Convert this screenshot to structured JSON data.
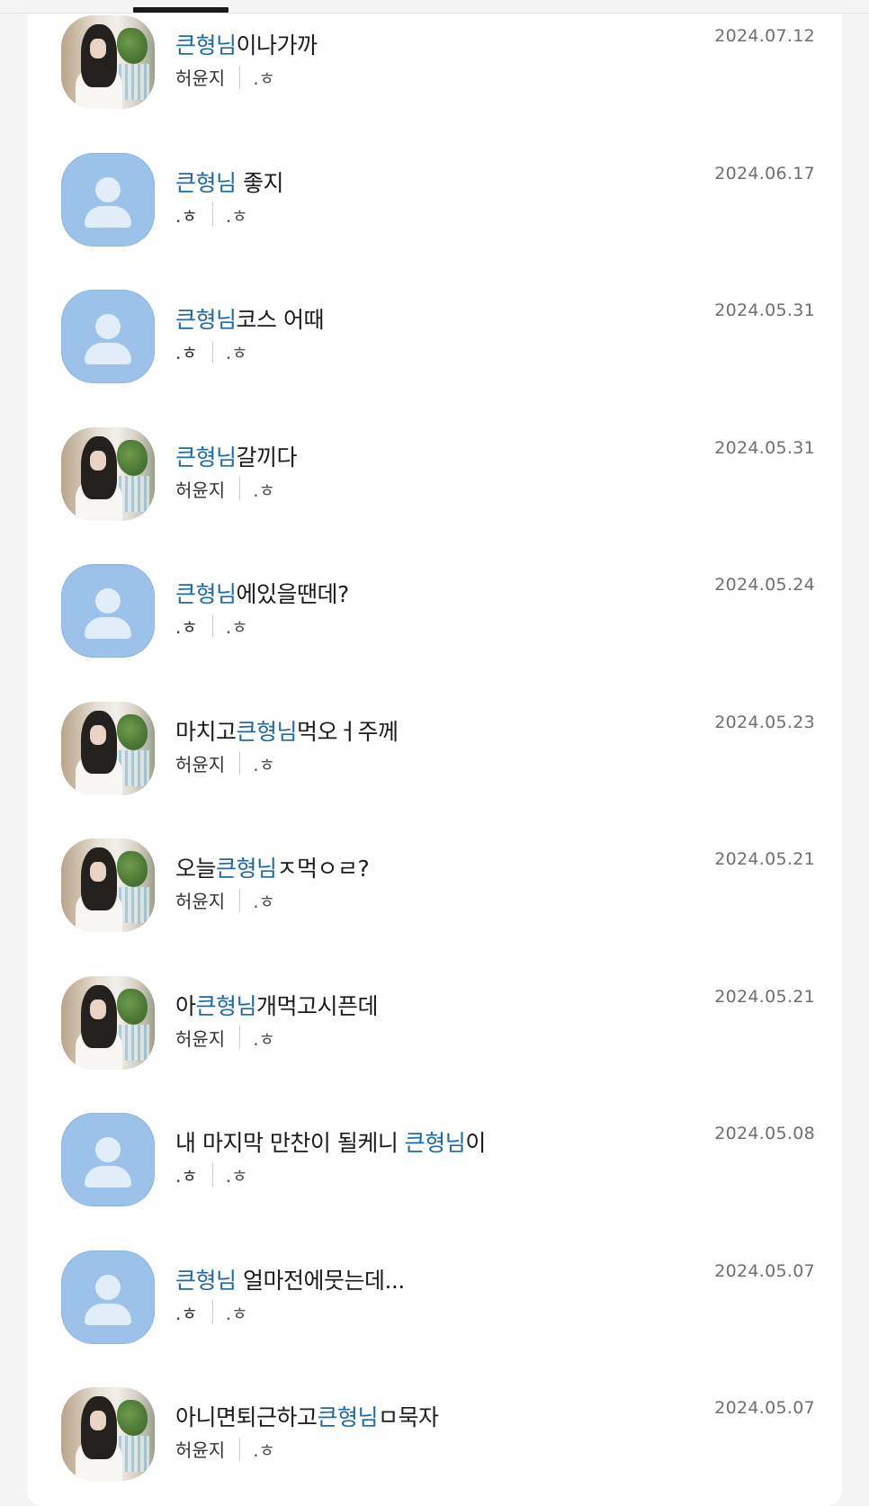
{
  "items": [
    {
      "avatar": "photo-avatar",
      "pre": "",
      "hl": "큰형님",
      "post": "이나가까",
      "author": "허윤지",
      "tag": ".ㅎ",
      "date": "2024.07.12"
    },
    {
      "avatar": "default-avatar",
      "pre": "",
      "hl": "큰형님",
      "post": " 좋지",
      "author": ".ㅎ",
      "tag": ".ㅎ",
      "date": "2024.06.17"
    },
    {
      "avatar": "default-avatar",
      "pre": "",
      "hl": "큰형님",
      "post": "코스 어때",
      "author": ".ㅎ",
      "tag": ".ㅎ",
      "date": "2024.05.31"
    },
    {
      "avatar": "photo-avatar",
      "pre": "",
      "hl": "큰형님",
      "post": "갈끼다",
      "author": "허윤지",
      "tag": ".ㅎ",
      "date": "2024.05.31"
    },
    {
      "avatar": "default-avatar",
      "pre": "",
      "hl": "큰형님",
      "post": "에있을땐데?",
      "author": ".ㅎ",
      "tag": ".ㅎ",
      "date": "2024.05.24"
    },
    {
      "avatar": "photo-avatar",
      "pre": "마치고",
      "hl": "큰형님",
      "post": "먹오ㅓ주께",
      "author": "허윤지",
      "tag": ".ㅎ",
      "date": "2024.05.23"
    },
    {
      "avatar": "photo-avatar",
      "pre": "오늘",
      "hl": "큰형님",
      "post": "ㅈ먹ㅇㄹ?",
      "author": "허윤지",
      "tag": ".ㅎ",
      "date": "2024.05.21"
    },
    {
      "avatar": "photo-avatar",
      "pre": "아",
      "hl": "큰형님",
      "post": "개먹고시픈데",
      "author": "허윤지",
      "tag": ".ㅎ",
      "date": "2024.05.21"
    },
    {
      "avatar": "default-avatar",
      "pre": "내 마지막 만찬이 될케니 ",
      "hl": "큰형님",
      "post": "이",
      "author": ".ㅎ",
      "tag": ".ㅎ",
      "date": "2024.05.08"
    },
    {
      "avatar": "default-avatar",
      "pre": "",
      "hl": "큰형님",
      "post": " 얼마전에뭇는데...",
      "author": ".ㅎ",
      "tag": ".ㅎ",
      "date": "2024.05.07"
    },
    {
      "avatar": "photo-avatar",
      "pre": "아니면퇴근하고",
      "hl": "큰형님",
      "post": "ㅁ묵자",
      "author": "허윤지",
      "tag": ".ㅎ",
      "date": "2024.05.07"
    }
  ]
}
